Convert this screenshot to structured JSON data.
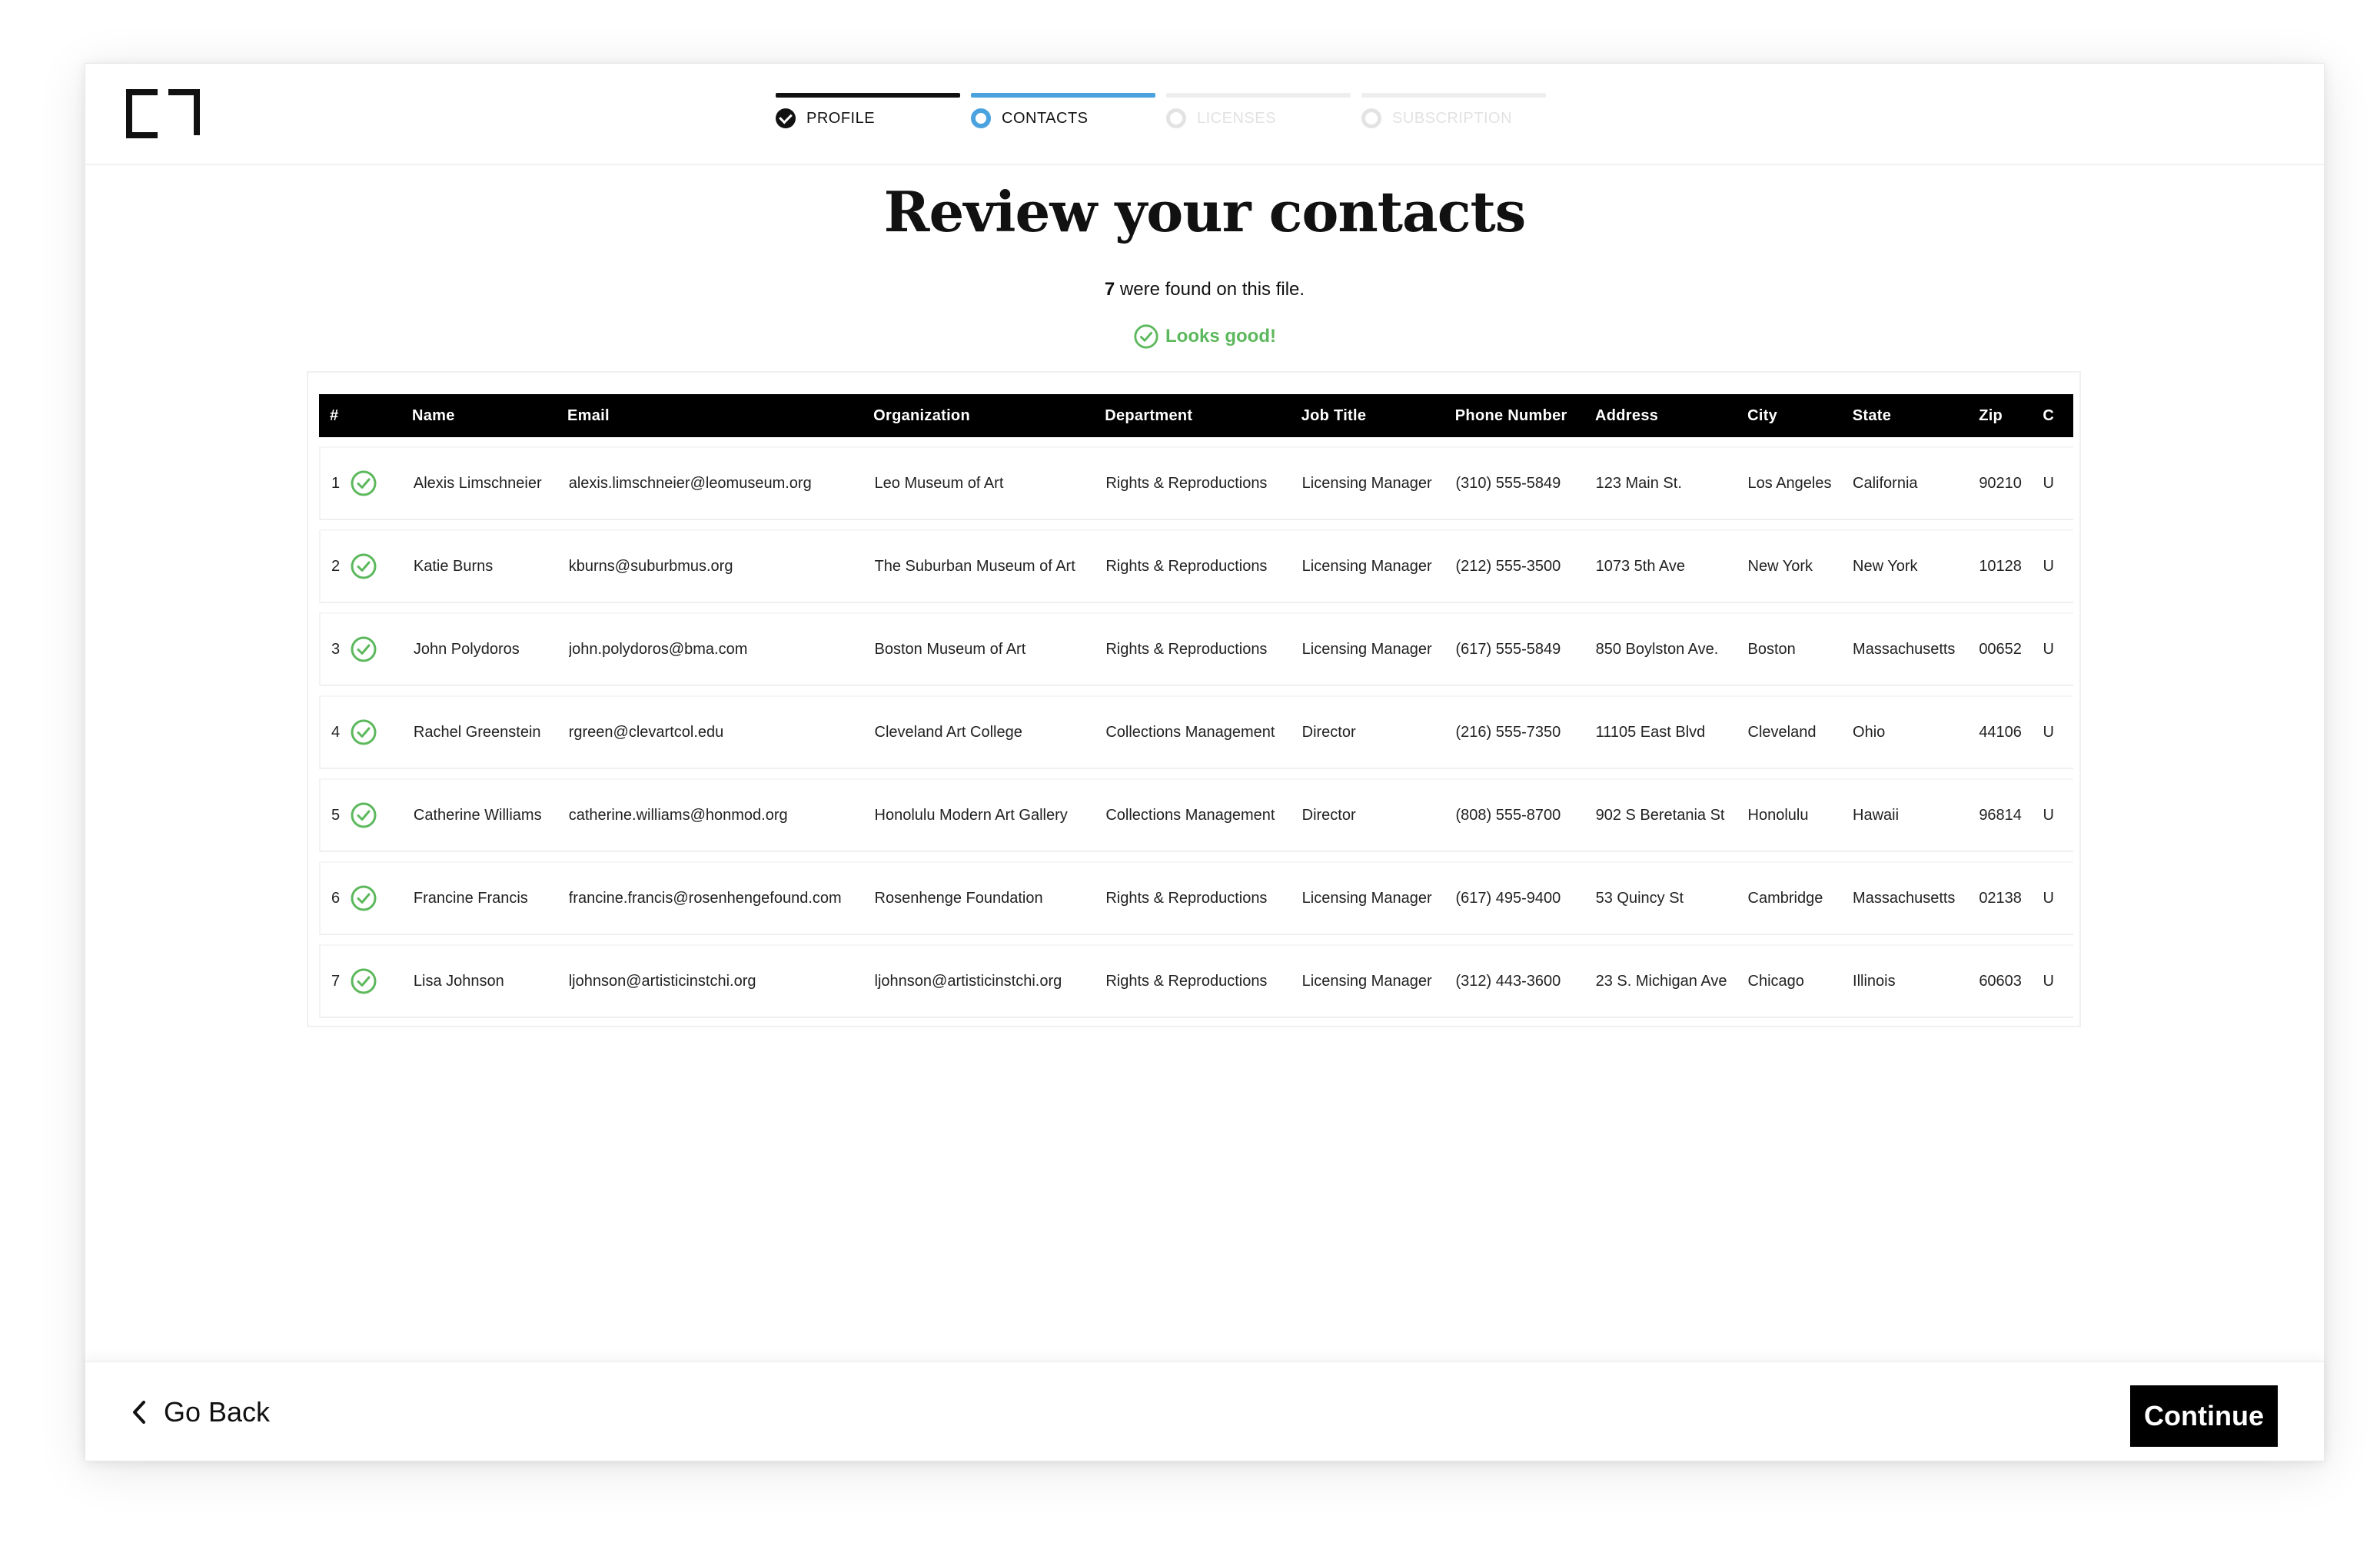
{
  "stepper": {
    "steps": [
      {
        "label": "PROFILE",
        "state": "done"
      },
      {
        "label": "CONTACTS",
        "state": "active"
      },
      {
        "label": "LICENSES",
        "state": "pending"
      },
      {
        "label": "SUBSCRIPTION",
        "state": "pending"
      }
    ]
  },
  "main": {
    "title": "Review your contacts",
    "count": "7",
    "count_suffix": " were found on this file.",
    "status": "Looks good!"
  },
  "colors": {
    "accent": "#4aa3df",
    "success": "#5cb85c",
    "header_bg": "#000000"
  },
  "table": {
    "headers": [
      "#",
      "",
      "Name",
      "Email",
      "Organization",
      "Department",
      "Job Title",
      "Phone Number",
      "Address",
      "City",
      "State",
      "Zip",
      "C"
    ],
    "rows": [
      {
        "num": "1",
        "name": "Alexis Limschneier",
        "email": "alexis.limschneier@leomuseum.org",
        "org": "Leo Museum of Art",
        "dept": "Rights & Reproductions",
        "job": "Licensing Manager",
        "phone": "(310) 555-5849",
        "addr": "123 Main St.",
        "city": "Los Angeles",
        "state": "California",
        "zip": "90210",
        "country": "U"
      },
      {
        "num": "2",
        "name": "Katie Burns",
        "email": "kburns@suburbmus.org",
        "org": "The Suburban Museum of Art",
        "dept": "Rights & Reproductions",
        "job": "Licensing Manager",
        "phone": "(212) 555-3500",
        "addr": "1073 5th Ave",
        "city": "New York",
        "state": "New York",
        "zip": "10128",
        "country": "U"
      },
      {
        "num": "3",
        "name": "John Polydoros",
        "email": "john.polydoros@bma.com",
        "org": "Boston Museum of Art",
        "dept": "Rights & Reproductions",
        "job": "Licensing Manager",
        "phone": "(617) 555-5849",
        "addr": "850 Boylston Ave.",
        "city": "Boston",
        "state": "Massachusetts",
        "zip": "00652",
        "country": "U"
      },
      {
        "num": "4",
        "name": "Rachel Greenstein",
        "email": "rgreen@clevartcol.edu",
        "org": "Cleveland Art College",
        "dept": "Collections Management",
        "job": "Director",
        "phone": "(216) 555-7350",
        "addr": "11105 East Blvd",
        "city": "Cleveland",
        "state": "Ohio",
        "zip": "44106",
        "country": "U"
      },
      {
        "num": "5",
        "name": "Catherine Williams",
        "email": "catherine.williams@honmod.org",
        "org": "Honolulu Modern Art Gallery",
        "dept": "Collections Management",
        "job": "Director",
        "phone": "(808) 555-8700",
        "addr": "902 S Beretania St",
        "city": "Honolulu",
        "state": "Hawaii",
        "zip": "96814",
        "country": "U"
      },
      {
        "num": "6",
        "name": "Francine Francis",
        "email": "francine.francis@rosenhengefound.com",
        "org": "Rosenhenge Foundation",
        "dept": "Rights & Reproductions",
        "job": "Licensing Manager",
        "phone": "(617) 495-9400",
        "addr": "53 Quincy St",
        "city": "Cambridge",
        "state": "Massachusetts",
        "zip": "02138",
        "country": "U"
      },
      {
        "num": "7",
        "name": "Lisa Johnson",
        "email": "ljohnson@artisticinstchi.org",
        "org": "ljohnson@artisticinstchi.org",
        "dept": "Rights & Reproductions",
        "job": "Licensing Manager",
        "phone": "(312) 443-3600",
        "addr": "23 S. Michigan Ave",
        "city": "Chicago",
        "state": "Illinois",
        "zip": "60603",
        "country": "U"
      }
    ]
  },
  "footer": {
    "back_label": "Go Back",
    "continue_label": "Continue"
  },
  "icons": {
    "logo": "bracket-logo-icon",
    "row_status": "check-circle-icon",
    "back": "chevron-left-icon"
  }
}
